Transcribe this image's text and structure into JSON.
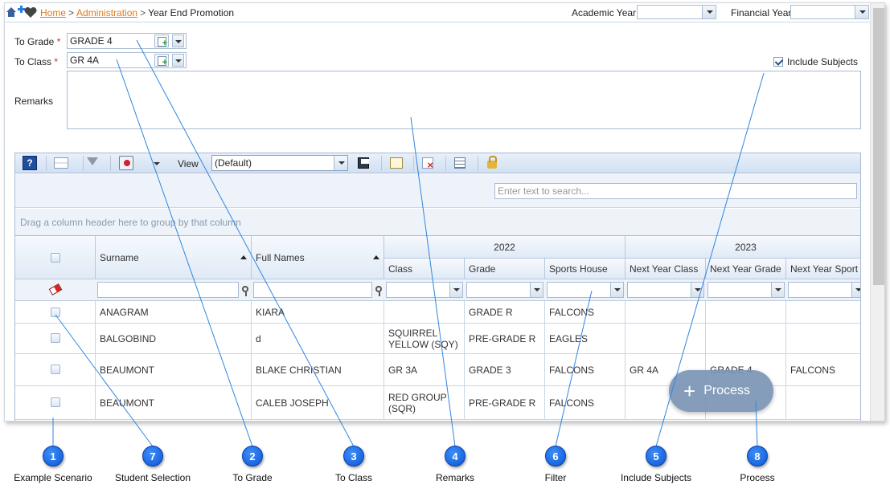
{
  "breadcrumb": {
    "home": "Home",
    "separator": ">",
    "admin": "Administration",
    "current": "Year End Promotion"
  },
  "header": {
    "academic_year_label": "Academic Year",
    "academic_year_value": "",
    "financial_year_label": "Financial Year",
    "financial_year_value": ""
  },
  "form": {
    "to_grade_label": "To Grade",
    "to_grade_value": "GRADE 4",
    "to_class_label": "To Class",
    "to_class_value": "GR 4A",
    "required_mark": "*",
    "include_subjects_label": "Include Subjects",
    "include_subjects_checked": true,
    "remarks_label": "Remarks",
    "remarks_value": ""
  },
  "toolbar": {
    "view_label": "View",
    "view_value": "(Default)",
    "icons": [
      "help-icon",
      "group-icon",
      "filter-icon",
      "export-icon",
      "save-icon",
      "new-view-icon",
      "delete-view-icon",
      "columns-icon",
      "lock-icon"
    ]
  },
  "grid": {
    "search_placeholder": "Enter text to search...",
    "group_hint": "Drag a column header here to group by that column",
    "band_2022": "2022",
    "band_2023": "2023",
    "columns": {
      "surname": "Surname",
      "full_names": "Full Names",
      "class": "Class",
      "grade": "Grade",
      "sports_house": "Sports House",
      "next_class": "Next Year Class",
      "next_grade": "Next Year Grade",
      "next_sport": "Next Year Sport"
    },
    "rows": [
      {
        "surname": "ANAGRAM",
        "full_names": "KIARA",
        "class": "",
        "grade": "GRADE R",
        "sports_house": "FALCONS",
        "next_class": "",
        "next_grade": "",
        "next_sport": ""
      },
      {
        "surname": "BALGOBIND",
        "full_names": "d",
        "class": "SQUIRREL YELLOW (SQY)",
        "grade": "PRE-GRADE R",
        "sports_house": "EAGLES",
        "next_class": "",
        "next_grade": "",
        "next_sport": ""
      },
      {
        "surname": "BEAUMONT",
        "full_names": "BLAKE CHRISTIAN",
        "class": "GR 3A",
        "grade": "GRADE 3",
        "sports_house": "FALCONS",
        "next_class": "GR 4A",
        "next_grade": "GRADE 4",
        "next_sport": "FALCONS"
      },
      {
        "surname": "BEAUMONT",
        "full_names": "CALEB JOSEPH",
        "class": "RED GROUP (SQR)",
        "grade": "PRE-GRADE R",
        "sports_house": "FALCONS",
        "next_class": "",
        "next_grade": "",
        "next_sport": ""
      }
    ]
  },
  "process_button": {
    "label": "Process",
    "icon": "+"
  },
  "callouts": [
    {
      "number": "1",
      "label": "Example Scenario"
    },
    {
      "number": "7",
      "label": "Student Selection"
    },
    {
      "number": "2",
      "label": "To Grade"
    },
    {
      "number": "3",
      "label": "To Class"
    },
    {
      "number": "4",
      "label": "Remarks"
    },
    {
      "number": "6",
      "label": "Filter"
    },
    {
      "number": "5",
      "label": "Include Subjects"
    },
    {
      "number": "8",
      "label": "Process"
    }
  ],
  "colors": {
    "link": "#e07b1a",
    "required": "#d9251d",
    "callout": "#1565e6",
    "line": "#2f86e0"
  }
}
